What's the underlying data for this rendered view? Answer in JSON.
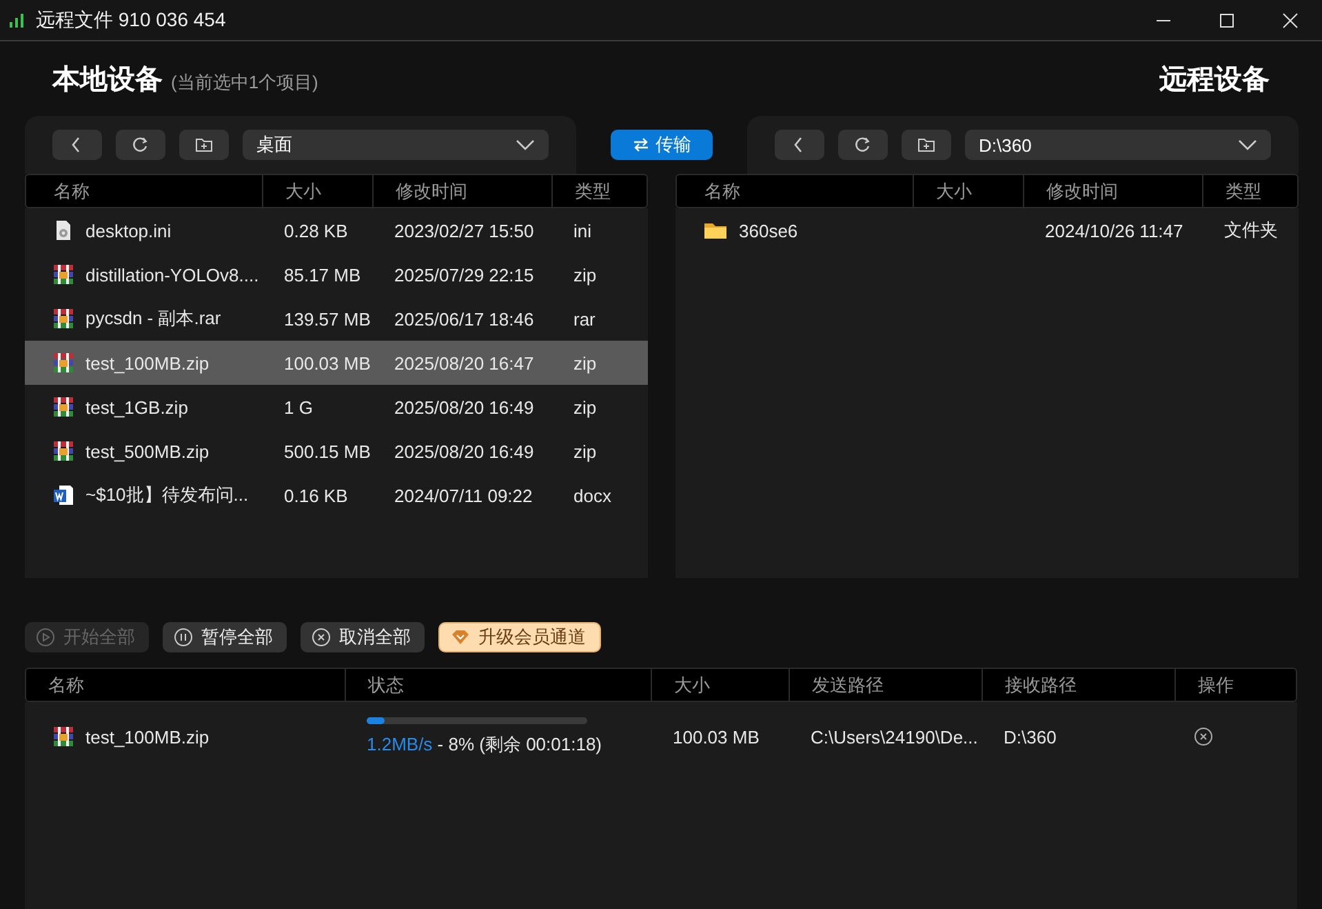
{
  "window": {
    "title": "远程文件 910 036 454"
  },
  "local": {
    "title": "本地设备",
    "subtitle": "(当前选中1个项目)",
    "path": "桌面",
    "columns": [
      "名称",
      "大小",
      "修改时间",
      "类型"
    ],
    "rows": [
      {
        "kind": "settings",
        "name": "desktop.ini",
        "size": "0.28 KB",
        "modified": "2023/02/27 15:50",
        "type": "ini",
        "selected": false
      },
      {
        "kind": "archive",
        "name": "distillation-YOLOv8....",
        "size": "85.17 MB",
        "modified": "2025/07/29 22:15",
        "type": "zip",
        "selected": false
      },
      {
        "kind": "archive",
        "name": "pycsdn - 副本.rar",
        "size": "139.57 MB",
        "modified": "2025/06/17 18:46",
        "type": "rar",
        "selected": false
      },
      {
        "kind": "archive",
        "name": "test_100MB.zip",
        "size": "100.03 MB",
        "modified": "2025/08/20 16:47",
        "type": "zip",
        "selected": true
      },
      {
        "kind": "archive",
        "name": "test_1GB.zip",
        "size": "1 G",
        "modified": "2025/08/20 16:49",
        "type": "zip",
        "selected": false
      },
      {
        "kind": "archive",
        "name": "test_500MB.zip",
        "size": "500.15 MB",
        "modified": "2025/08/20 16:49",
        "type": "zip",
        "selected": false
      },
      {
        "kind": "word",
        "name": "~$10批】待发布问...",
        "size": "0.16 KB",
        "modified": "2024/07/11 09:22",
        "type": "docx",
        "selected": false
      }
    ]
  },
  "transfer_button": "传输",
  "remote": {
    "title": "远程设备",
    "path": "D:\\360",
    "columns": [
      "名称",
      "大小",
      "修改时间",
      "类型"
    ],
    "rows": [
      {
        "kind": "folder",
        "name": "360se6",
        "size": "",
        "modified": "2024/10/26 11:47",
        "type": "文件夹",
        "selected": false
      }
    ]
  },
  "actions": [
    {
      "kind": "play",
      "label": "开始全部",
      "disabled": true
    },
    {
      "kind": "pause",
      "label": "暂停全部",
      "disabled": false
    },
    {
      "kind": "cancel",
      "label": "取消全部",
      "disabled": false
    },
    {
      "kind": "vip",
      "label": "升级会员通道",
      "disabled": false
    }
  ],
  "transfers": {
    "columns": [
      "名称",
      "状态",
      "大小",
      "发送路径",
      "接收路径",
      "操作"
    ],
    "rows": [
      {
        "kind": "archive",
        "name": "test_100MB.zip",
        "level": 0.08,
        "speed": "1.2MB/s",
        "status": " - 8% (剩余 00:01:18)",
        "size": "100.03 MB",
        "from": "C:\\Users\\24190\\De...",
        "to": "D:\\360"
      }
    ]
  }
}
